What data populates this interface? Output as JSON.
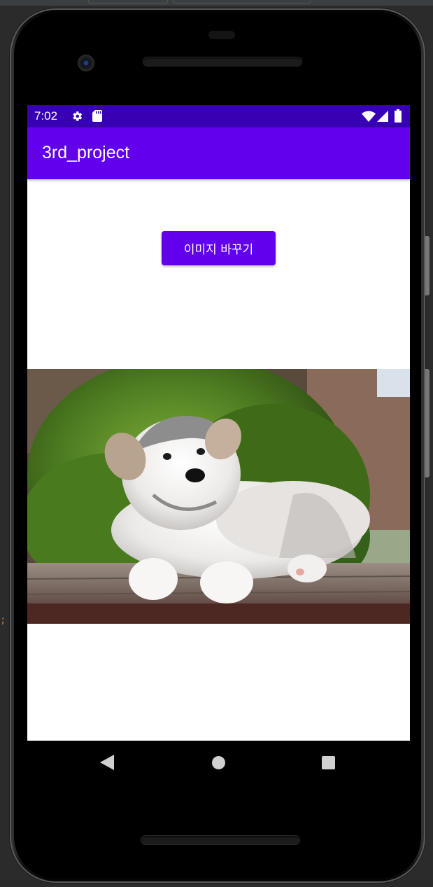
{
  "status_bar": {
    "time": "7:02",
    "icons": [
      "settings-gear-icon",
      "sd-card-icon",
      "wifi-icon",
      "cell-signal-icon",
      "battery-icon"
    ]
  },
  "app_bar": {
    "title": "3rd_project"
  },
  "main": {
    "change_image_button_label": "이미지 바꾸기",
    "image_subject": "puppy-photo"
  },
  "nav_bar": {
    "icons": [
      "back-icon",
      "home-icon",
      "recents-icon"
    ]
  },
  "colors": {
    "status_bar": "#3700b3",
    "primary": "#6200ee",
    "on_primary": "#ffffff",
    "background": "#ffffff"
  }
}
